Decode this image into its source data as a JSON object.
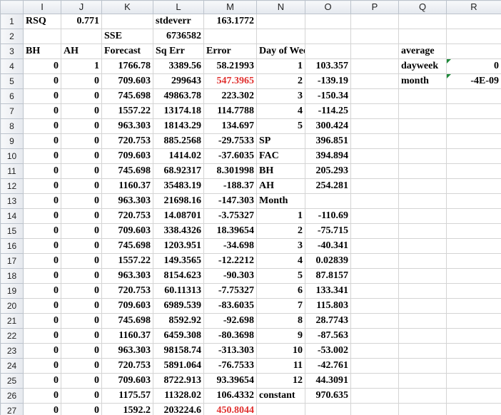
{
  "columns": [
    "I",
    "J",
    "K",
    "L",
    "M",
    "N",
    "O",
    "P",
    "Q",
    "R"
  ],
  "rows": [
    {
      "n": "1",
      "cells": [
        "RSQ",
        "0.771",
        "",
        "stdeverr",
        "163.1772",
        "",
        "",
        "",
        "",
        ""
      ]
    },
    {
      "n": "2",
      "cells": [
        "",
        "",
        "SSE",
        "6736582",
        "",
        "",
        "",
        "",
        "",
        ""
      ]
    },
    {
      "n": "3",
      "cells": [
        "BH",
        "AH",
        "Forecast",
        "Sq Err",
        "Error",
        "Day of Week",
        "",
        "",
        "average",
        ""
      ]
    },
    {
      "n": "4",
      "cells": [
        "0",
        "1",
        "1766.78",
        "3389.56",
        "58.21993",
        "1",
        "103.357",
        "",
        "dayweek",
        "0"
      ]
    },
    {
      "n": "5",
      "cells": [
        "0",
        "0",
        "709.603",
        "299643",
        "547.3965",
        "2",
        "-139.19",
        "",
        "month",
        "-4E-09"
      ]
    },
    {
      "n": "6",
      "cells": [
        "0",
        "0",
        "745.698",
        "49863.78",
        "223.302",
        "3",
        "-150.34",
        "",
        "",
        ""
      ]
    },
    {
      "n": "7",
      "cells": [
        "0",
        "0",
        "1557.22",
        "13174.18",
        "114.7788",
        "4",
        "-114.25",
        "",
        "",
        ""
      ]
    },
    {
      "n": "8",
      "cells": [
        "0",
        "0",
        "963.303",
        "18143.29",
        "134.697",
        "5",
        "300.424",
        "",
        "",
        ""
      ]
    },
    {
      "n": "9",
      "cells": [
        "0",
        "0",
        "720.753",
        "885.2568",
        "-29.7533",
        "SP",
        "396.851",
        "",
        "",
        ""
      ]
    },
    {
      "n": "10",
      "cells": [
        "0",
        "0",
        "709.603",
        "1414.02",
        "-37.6035",
        "FAC",
        "394.894",
        "",
        "",
        ""
      ]
    },
    {
      "n": "11",
      "cells": [
        "0",
        "0",
        "745.698",
        "68.92317",
        "8.301998",
        "BH",
        "205.293",
        "",
        "",
        ""
      ]
    },
    {
      "n": "12",
      "cells": [
        "0",
        "0",
        "1160.37",
        "35483.19",
        "-188.37",
        "AH",
        "254.281",
        "",
        "",
        ""
      ]
    },
    {
      "n": "13",
      "cells": [
        "0",
        "0",
        "963.303",
        "21698.16",
        "-147.303",
        "Month",
        "",
        "",
        "",
        ""
      ]
    },
    {
      "n": "14",
      "cells": [
        "0",
        "0",
        "720.753",
        "14.08701",
        "-3.75327",
        "1",
        "-110.69",
        "",
        "",
        ""
      ]
    },
    {
      "n": "15",
      "cells": [
        "0",
        "0",
        "709.603",
        "338.4326",
        "18.39654",
        "2",
        "-75.715",
        "",
        "",
        ""
      ]
    },
    {
      "n": "16",
      "cells": [
        "0",
        "0",
        "745.698",
        "1203.951",
        "-34.698",
        "3",
        "-40.341",
        "",
        "",
        ""
      ]
    },
    {
      "n": "17",
      "cells": [
        "0",
        "0",
        "1557.22",
        "149.3565",
        "-12.2212",
        "4",
        "0.02839",
        "",
        "",
        ""
      ]
    },
    {
      "n": "18",
      "cells": [
        "0",
        "0",
        "963.303",
        "8154.623",
        "-90.303",
        "5",
        "87.8157",
        "",
        "",
        ""
      ]
    },
    {
      "n": "19",
      "cells": [
        "0",
        "0",
        "720.753",
        "60.11313",
        "-7.75327",
        "6",
        "133.341",
        "",
        "",
        ""
      ]
    },
    {
      "n": "20",
      "cells": [
        "0",
        "0",
        "709.603",
        "6989.539",
        "-83.6035",
        "7",
        "115.803",
        "",
        "",
        ""
      ]
    },
    {
      "n": "21",
      "cells": [
        "0",
        "0",
        "745.698",
        "8592.92",
        "-92.698",
        "8",
        "28.7743",
        "",
        "",
        ""
      ]
    },
    {
      "n": "22",
      "cells": [
        "0",
        "0",
        "1160.37",
        "6459.308",
        "-80.3698",
        "9",
        "-87.563",
        "",
        "",
        ""
      ]
    },
    {
      "n": "23",
      "cells": [
        "0",
        "0",
        "963.303",
        "98158.74",
        "-313.303",
        "10",
        "-53.002",
        "",
        "",
        ""
      ]
    },
    {
      "n": "24",
      "cells": [
        "0",
        "0",
        "720.753",
        "5891.064",
        "-76.7533",
        "11",
        "-42.761",
        "",
        "",
        ""
      ]
    },
    {
      "n": "25",
      "cells": [
        "0",
        "0",
        "709.603",
        "8722.913",
        "93.39654",
        "12",
        "44.3091",
        "",
        "",
        ""
      ]
    },
    {
      "n": "26",
      "cells": [
        "0",
        "0",
        "1175.57",
        "11328.02",
        "106.4332",
        "constant",
        "970.635",
        "",
        "",
        ""
      ]
    },
    {
      "n": "27",
      "cells": [
        "0",
        "0",
        "1592.2",
        "203224.6",
        "450.8044",
        "",
        "",
        "",
        "",
        ""
      ]
    }
  ],
  "highlight_color": "#e0312f",
  "indicator_color": "#1e8a3a"
}
